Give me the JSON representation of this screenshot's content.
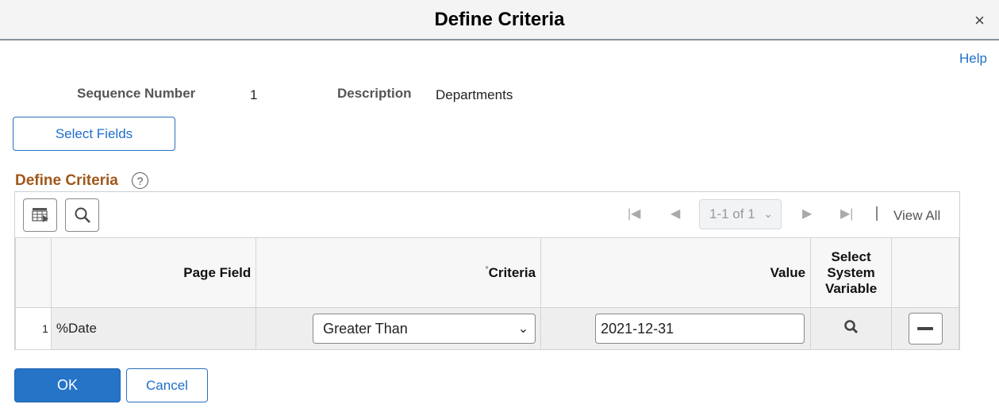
{
  "dialog": {
    "title": "Define Criteria",
    "close_icon": "×"
  },
  "help_link": "Help",
  "header": {
    "sequence_label": "Sequence Number",
    "sequence_value": "1",
    "description_label": "Description",
    "description_value": "Departments"
  },
  "select_fields_button": "Select Fields",
  "section": {
    "title": "Define Criteria",
    "help_icon": "?"
  },
  "grid": {
    "pager": {
      "text": "1-1 of 1",
      "view_all": "View All"
    },
    "columns": [
      "",
      "Page Field",
      "Criteria",
      "Value",
      "Select System Variable",
      ""
    ],
    "criteria_required_marker": "*",
    "rows": [
      {
        "num": "1",
        "page_field": "%Date",
        "criteria": "Greater Than",
        "value": "2021-12-31"
      }
    ]
  },
  "footer": {
    "ok": "OK",
    "cancel": "Cancel"
  }
}
